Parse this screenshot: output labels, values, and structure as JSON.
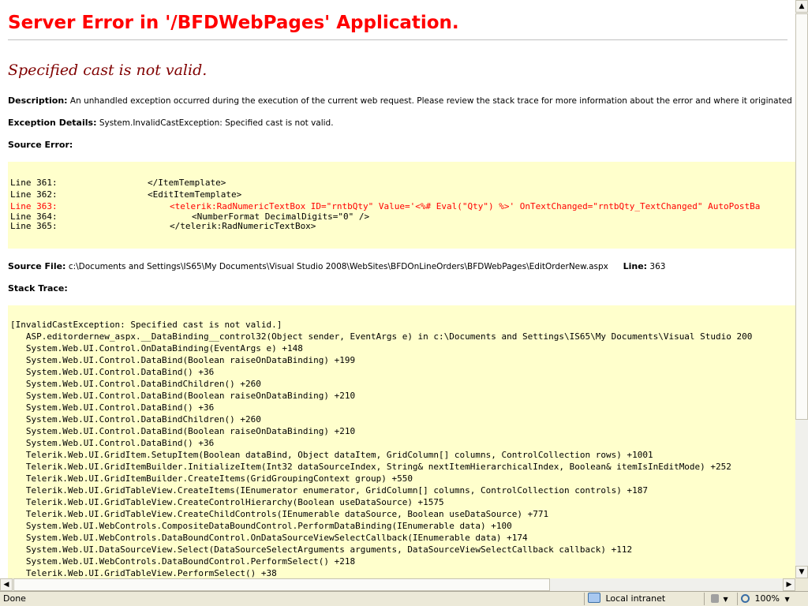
{
  "page": {
    "title": "Server Error in '/BFDWebPages' Application.",
    "message": "Specified cast is not valid.",
    "description_label": "Description:",
    "description_text": "An unhandled exception occurred during the execution of the current web request. Please review the stack trace for more information about the error and where it originated in the code.",
    "exception_label": "Exception Details:",
    "exception_text": "System.InvalidCastException: Specified cast is not valid.",
    "source_error_label": "Source Error:",
    "source_lines": [
      {
        "num": "Line 361:",
        "code": "</ItemTemplate>",
        "indent": 0,
        "error": false
      },
      {
        "num": "Line 362:",
        "code": "<EditItemTemplate>",
        "indent": 0,
        "error": false
      },
      {
        "num": "Line 363:",
        "code": "<telerik:RadNumericTextBox ID=\"rntbQty\" Value='<%# Eval(\"Qty\") %>' OnTextChanged=\"rntbQty_TextChanged\" AutoPostBa",
        "indent": 1,
        "error": true
      },
      {
        "num": "Line 364:",
        "code": "<NumberFormat DecimalDigits=\"0\" />",
        "indent": 2,
        "error": false
      },
      {
        "num": "Line 365:",
        "code": "</telerik:RadNumericTextBox>",
        "indent": 1,
        "error": false
      }
    ],
    "source_file_label": "Source File:",
    "source_file_text": "c:\\Documents and Settings\\IS65\\My Documents\\Visual Studio 2008\\WebSites\\BFDOnLineOrders\\BFDWebPages\\EditOrderNew.aspx",
    "line_label": "Line:",
    "line_number": "363",
    "stack_trace_label": "Stack Trace:",
    "stack_trace": [
      "[InvalidCastException: Specified cast is not valid.]",
      "   ASP.editordernew_aspx.__DataBinding__control32(Object sender, EventArgs e) in c:\\Documents and Settings\\IS65\\My Documents\\Visual Studio 200",
      "   System.Web.UI.Control.OnDataBinding(EventArgs e) +148",
      "   System.Web.UI.Control.DataBind(Boolean raiseOnDataBinding) +199",
      "   System.Web.UI.Control.DataBind() +36",
      "   System.Web.UI.Control.DataBindChildren() +260",
      "   System.Web.UI.Control.DataBind(Boolean raiseOnDataBinding) +210",
      "   System.Web.UI.Control.DataBind() +36",
      "   System.Web.UI.Control.DataBindChildren() +260",
      "   System.Web.UI.Control.DataBind(Boolean raiseOnDataBinding) +210",
      "   System.Web.UI.Control.DataBind() +36",
      "   Telerik.Web.UI.GridItem.SetupItem(Boolean dataBind, Object dataItem, GridColumn[] columns, ControlCollection rows) +1001",
      "   Telerik.Web.UI.GridItemBuilder.InitializeItem(Int32 dataSourceIndex, String& nextItemHierarchicalIndex, Boolean& itemIsInEditMode) +252",
      "   Telerik.Web.UI.GridItemBuilder.CreateItems(GridGroupingContext group) +550",
      "   Telerik.Web.UI.GridTableView.CreateItems(IEnumerator enumerator, GridColumn[] columns, ControlCollection controls) +187",
      "   Telerik.Web.UI.GridTableView.CreateControlHierarchy(Boolean useDataSource) +1575",
      "   Telerik.Web.UI.GridTableView.CreateChildControls(IEnumerable dataSource, Boolean useDataSource) +771",
      "   System.Web.UI.WebControls.CompositeDataBoundControl.PerformDataBinding(IEnumerable data) +100",
      "   System.Web.UI.WebControls.DataBoundControl.OnDataSourceViewSelectCallback(IEnumerable data) +174",
      "   System.Web.UI.DataSourceView.Select(DataSourceSelectArguments arguments, DataSourceViewSelectCallback callback) +112",
      "   System.Web.UI.WebControls.DataBoundControl.PerformSelect() +218",
      "   Telerik.Web.UI.GridTableView.PerformSelect() +38"
    ]
  },
  "statusbar": {
    "status_text": "Done",
    "zone_text": "Local intranet",
    "zoom_text": "100%",
    "zone_icon": "globe-intranet-icon",
    "zoom_icon": "zoom-icon"
  },
  "colors": {
    "title": "#ff0000",
    "message": "#800000",
    "code_background": "#ffffcc",
    "error_line": "#ff0000"
  }
}
